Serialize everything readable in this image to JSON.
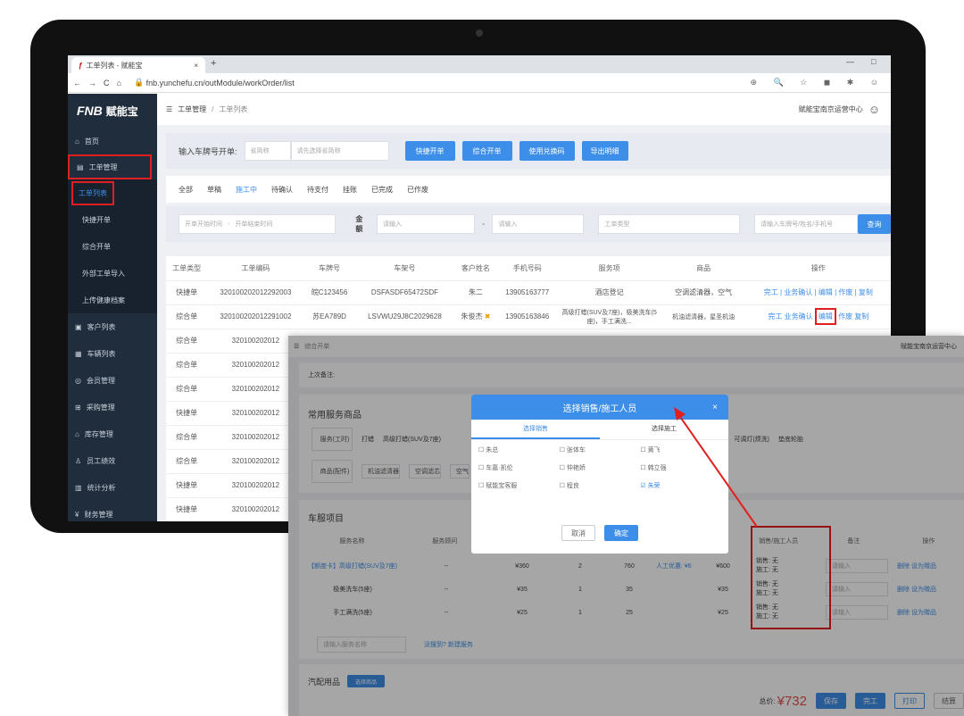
{
  "browser": {
    "tab_title": "工单列表 - 赋能宝",
    "new_tab": "+",
    "url": "fnb.yunchefu.cn/outModule/workOrder/list",
    "min": "—",
    "max": "□"
  },
  "header": {
    "logo": "FNB",
    "logo_text": "赋能宝",
    "breadcrumb_root": "工单管理",
    "breadcrumb_sep": "/",
    "breadcrumb_current": "工单列表",
    "center": "赋能宝南京运营中心"
  },
  "sidebar": [
    {
      "label": "首页"
    },
    {
      "label": "工单管理"
    },
    {
      "label": "工单列表"
    },
    {
      "label": "快捷开单"
    },
    {
      "label": "综合开单"
    },
    {
      "label": "外部工单导入"
    },
    {
      "label": "上传健康档案"
    },
    {
      "label": "客户列表"
    },
    {
      "label": "车辆列表"
    },
    {
      "label": "会员管理"
    },
    {
      "label": "采购管理"
    },
    {
      "label": "库存管理"
    },
    {
      "label": "员工绩效"
    },
    {
      "label": "统计分析"
    },
    {
      "label": "财务管理"
    }
  ],
  "plate": {
    "label": "输入车牌号开单:",
    "province": "省简称",
    "placeholder": "请先选择省简称"
  },
  "actions": [
    "快捷开单",
    "综合开单",
    "使用兑换码",
    "导出明细"
  ],
  "status_tabs": [
    "全部",
    "草稿",
    "施工中",
    "待确认",
    "待支付",
    "挂账",
    "已完成",
    "已作废"
  ],
  "filter": {
    "start": "开单开始时间",
    "sep": "-",
    "end": "开单结束时间",
    "amount": "金额",
    "min": "请输入",
    "dash": "-",
    "max": "请输入",
    "type": "工单类型",
    "search_ph": "请输入车牌号/姓名/手机号",
    "query": "查询"
  },
  "table": {
    "headers": [
      "工单类型",
      "工单编码",
      "车牌号",
      "车架号",
      "客户姓名",
      "手机号码",
      "服务项",
      "商品",
      "操作"
    ],
    "rows": [
      {
        "type": "快捷单",
        "code": "320100202012292003",
        "plate": "皖C123456",
        "vin": "DSFASDF65472SDF",
        "name": "朱二",
        "phone": "13905163777",
        "service": "酒店登记",
        "goods": "空调滤清器，空气"
      },
      {
        "type": "综合单",
        "code": "320100202012291002",
        "plate": "苏EA789D",
        "vin": "LSVWU29J8C2029628",
        "name": "朱俊杰",
        "phone": "13905163846",
        "service": "高级打蜡(SUV及7座)，极美洗车(5座)，手工满洗...",
        "goods": "机油滤清器，星圣机油"
      },
      {
        "type": "综合单",
        "code": "320100202012"
      },
      {
        "type": "综合单",
        "code": "320100202012"
      },
      {
        "type": "综合单",
        "code": "320100202012"
      },
      {
        "type": "快捷单",
        "code": "320100202012"
      },
      {
        "type": "综合单",
        "code": "320100202012"
      },
      {
        "type": "综合单",
        "code": "320100202012"
      },
      {
        "type": "快捷单",
        "code": "320100202012"
      },
      {
        "type": "快捷单",
        "code": "320100202012"
      }
    ],
    "ops": [
      "完工",
      "业务确认",
      "编辑",
      "作废",
      "复制"
    ]
  },
  "overlay": {
    "title": "综合开单",
    "center": "赋能宝南京运营中心",
    "remark_label": "上次备注:",
    "common": "常用服务商品",
    "svc_label": "服务(工时)",
    "svc_items": [
      "打蜡",
      "高级打蜡(SUV及7座)"
    ],
    "goods_label": "商品(配件)",
    "goods_items": [
      "机油滤清器",
      "空调滤芯",
      "空气"
    ],
    "more": [
      "可调灯(烦洗)",
      "垫底轮胎"
    ],
    "section": "车服项目",
    "cols": [
      "服务名称",
      "服务顾问",
      "销售/施工人员",
      "备注",
      "操作"
    ],
    "items": [
      {
        "name": "【额度卡】高级打蜡(SUV及7座)",
        "adv": "--",
        "price": "¥360",
        "qty": "2",
        "unit": "760",
        "sub": "人工优惠: ¥6",
        "total": "¥600",
        "staff1": "销售: 无",
        "staff2": "施工: 无",
        "note": "请输入",
        "op1": "删除",
        "op2": "设为赠品"
      },
      {
        "name": "极美洗车(5座)",
        "adv": "--",
        "price": "¥35",
        "qty": "1",
        "unit": "35",
        "sub": "",
        "total": "¥35",
        "staff1": "销售: 无",
        "staff2": "施工: 无",
        "note": "请输入",
        "op1": "删除",
        "op2": "设为赠品"
      },
      {
        "name": "手工满洗(5座)",
        "adv": "--",
        "price": "¥25",
        "qty": "1",
        "unit": "25",
        "sub": "",
        "total": "¥25",
        "staff1": "销售: 无",
        "staff2": "施工: 无",
        "note": "请输入",
        "op1": "删除",
        "op2": "设为赠品"
      }
    ],
    "search_ph": "请输入服务名称",
    "not_found": "没搜到?",
    "new_service": "新建服务",
    "parts": "汽配用品",
    "parts_btn": "选择商品",
    "total_label": "总价:",
    "total": "¥732",
    "save": "保存",
    "finish": "完工",
    "print": "打印",
    "more_btn": "结算"
  },
  "modal": {
    "title": "选择销售/施工人员",
    "close": "×",
    "tab1": "选择销售",
    "tab2": "选择施工",
    "people": [
      [
        "朱总",
        "张体车",
        "黄飞"
      ],
      [
        "车嘉·凯伦",
        "仲艳娇",
        "韩立强"
      ],
      [
        "赋能宝客服",
        "程良",
        "朱荣"
      ]
    ],
    "cancel": "取消",
    "ok": "确定"
  },
  "colors": {
    "accent": "#3d8ee8",
    "sidebar": "#1f2d3d",
    "highlight": "#e02020"
  }
}
